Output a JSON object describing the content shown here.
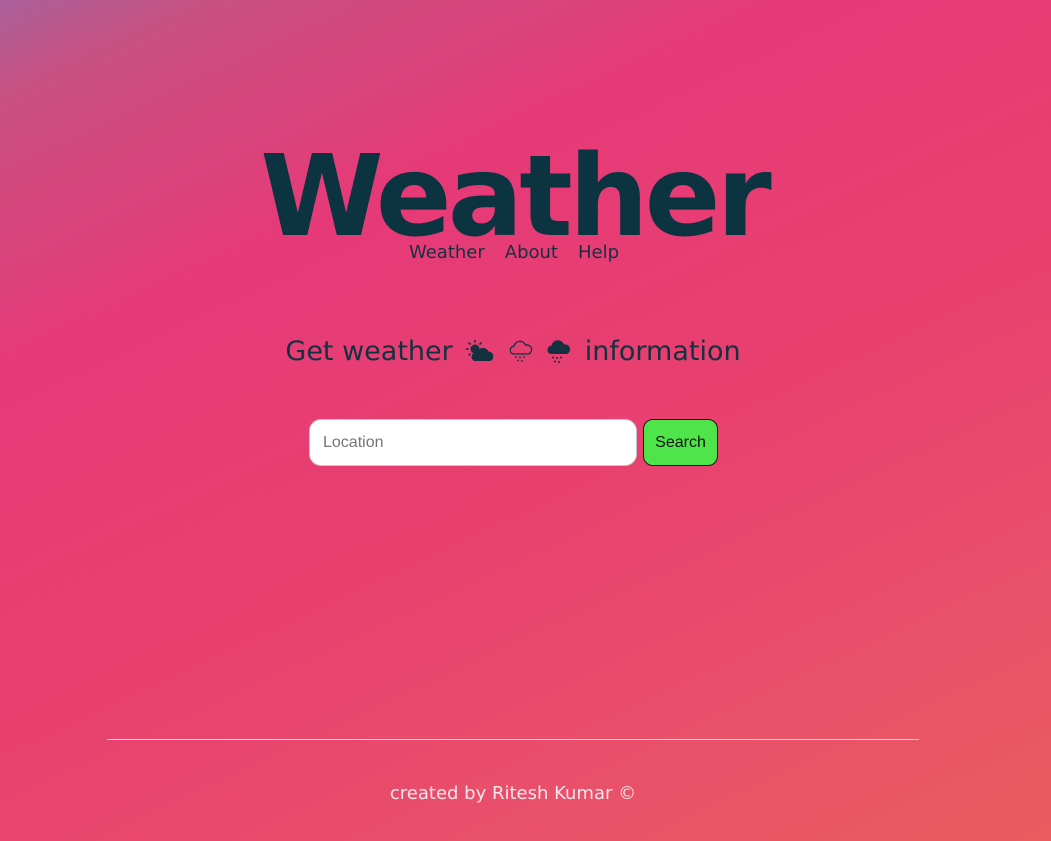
{
  "header": {
    "title": "Weather"
  },
  "nav": {
    "items": [
      {
        "label": "Weather"
      },
      {
        "label": "About"
      },
      {
        "label": "Help"
      }
    ]
  },
  "tagline": {
    "before": "Get weather",
    "after": "information",
    "icons": [
      "sun-behind-cloud-icon",
      "rain-cloud-outline-icon",
      "rain-cloud-icon"
    ]
  },
  "search": {
    "placeholder": "Location",
    "value": "",
    "button_label": "Search"
  },
  "footer": {
    "text": "created by Ritesh Kumar ©"
  },
  "colors": {
    "title": "#0b3440",
    "text_dark": "#14313f",
    "search_button": "#4ee44a",
    "footer_text": "#fde6ec",
    "background_start": "#a9609a",
    "background_mid": "#e63a78",
    "background_end": "#ea5c60"
  }
}
